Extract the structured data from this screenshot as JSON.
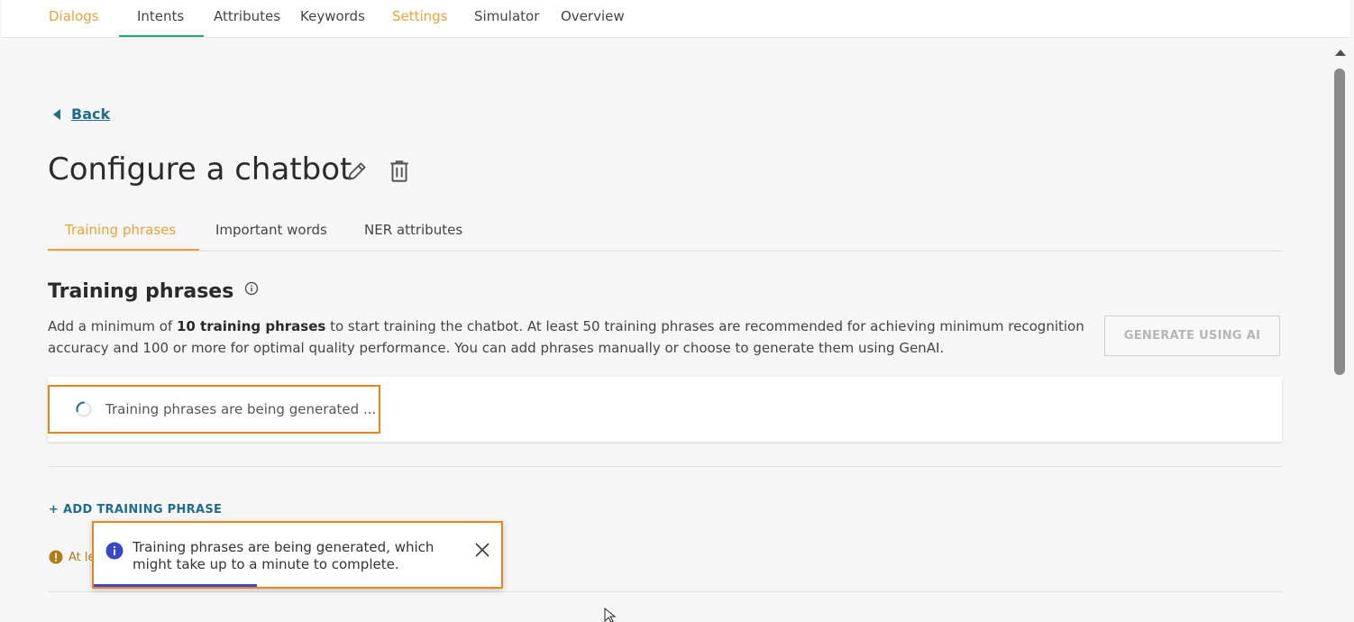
{
  "top_nav": {
    "items": [
      {
        "label": "Dialogs",
        "color": "#e8a33a"
      },
      {
        "label": "Intents",
        "active": true
      },
      {
        "label": "Attributes"
      },
      {
        "label": "Keywords"
      },
      {
        "label": "Settings",
        "color": "#e8a33a"
      },
      {
        "label": "Simulator"
      },
      {
        "label": "Overview"
      }
    ],
    "active_underline_color": "#21a67a"
  },
  "back": {
    "label": "Back",
    "icon": "caret-left-icon"
  },
  "page": {
    "title": "Configure a chatbot",
    "edit_icon": "pencil-icon",
    "delete_icon": "trash-icon"
  },
  "tabs": [
    {
      "label": "Training phrases",
      "active": true
    },
    {
      "label": "Important words"
    },
    {
      "label": "NER attributes"
    }
  ],
  "section": {
    "title": "Training phrases",
    "info_icon": "info-circle-icon",
    "description_pre": "Add a minimum of ",
    "description_bold": "10 training phrases",
    "description_post": " to start training the chatbot. At least 50 training phrases are recommended for achieving minimum recognition accuracy and 100 or more for optimal quality performance. You can add phrases manually or choose to generate them using GenAI.",
    "generate_button": "GENERATE USING AI"
  },
  "generation_status": {
    "text": "Training phrases are being generated ...",
    "icon": "spinner-icon"
  },
  "add_phrase_link": "+ ADD TRAINING PHRASE",
  "warning": {
    "text": "At le",
    "icon": "exclamation-circle-icon",
    "color": "#b47a14"
  },
  "toast": {
    "message": "Training phrases are being generated, which might take up to a minute to complete.",
    "icon": "info-icon",
    "close_icon": "close-icon",
    "progress": 0.4
  },
  "colors": {
    "accent_orange": "#e8a33a",
    "highlight_border": "#e8861a",
    "link_blue": "#1f6d8a",
    "info_blue": "#3848c6"
  }
}
